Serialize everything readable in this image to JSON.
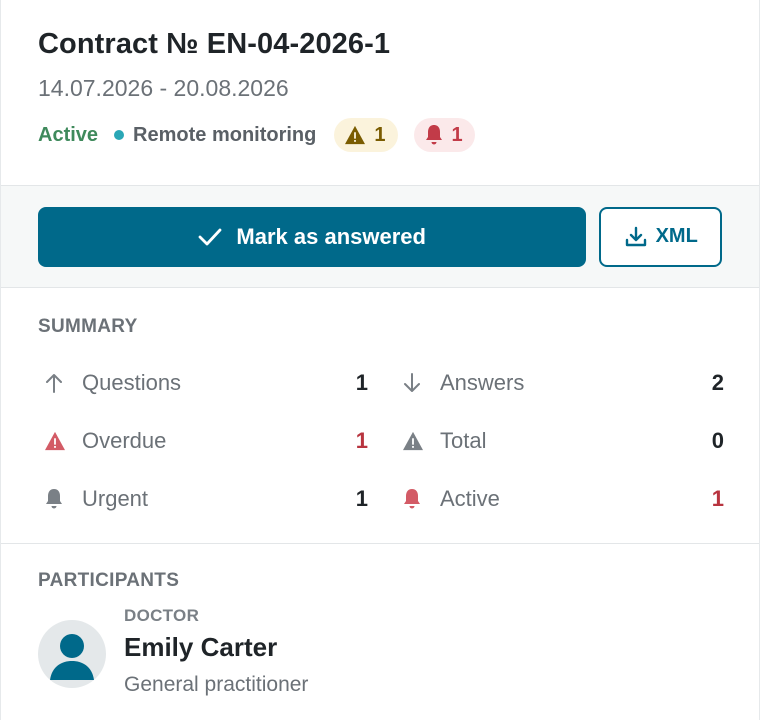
{
  "header": {
    "title": "Contract № EN-04-2026-1",
    "dates": "14.07.2026 - 20.08.2026",
    "status": "Active",
    "mode": "Remote monitoring",
    "warning_count": "1",
    "alert_count": "1"
  },
  "actions": {
    "primary_label": "Mark as answered",
    "xml_label": "XML"
  },
  "summary": {
    "title": "SUMMARY",
    "items": [
      {
        "label": "Questions",
        "value": "1",
        "icon": "arrow-up-icon",
        "value_color": "#1f2428"
      },
      {
        "label": "Answers",
        "value": "2",
        "icon": "arrow-down-icon",
        "value_color": "#1f2428"
      },
      {
        "label": "Overdue",
        "value": "1",
        "icon": "warning-icon",
        "value_color": "#b8343f"
      },
      {
        "label": "Total",
        "value": "0",
        "icon": "warning-icon",
        "value_color": "#1f2428"
      },
      {
        "label": "Urgent",
        "value": "1",
        "icon": "bell-icon",
        "value_color": "#1f2428"
      },
      {
        "label": "Active",
        "value": "1",
        "icon": "bell-icon",
        "value_color": "#b8343f"
      }
    ]
  },
  "participants": {
    "title": "PARTICIPANTS",
    "people": [
      {
        "role": "DOCTOR",
        "name": "Emily Carter",
        "specialty": "General practitioner"
      }
    ]
  },
  "colors": {
    "primary": "#00698a",
    "success": "#3f8a5c",
    "danger": "#b8343f",
    "warning": "#7a5c00",
    "accent_dot": "#2aa7b6"
  }
}
